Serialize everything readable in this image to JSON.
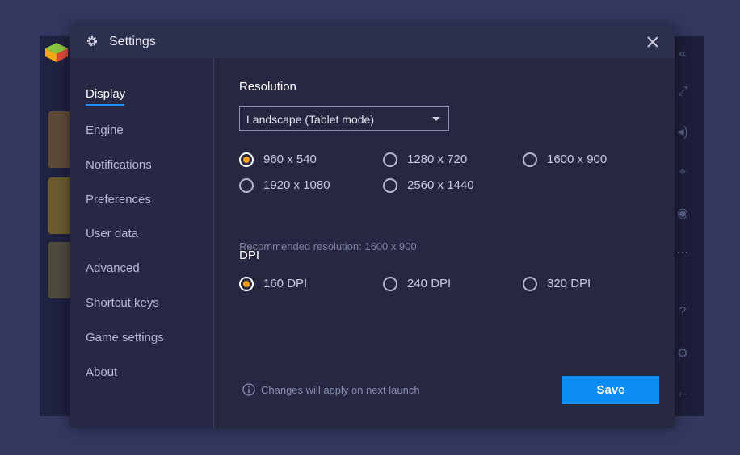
{
  "dialog": {
    "title": "Settings",
    "title_icon": "gear-icon",
    "close_icon": "close-icon"
  },
  "sidebar": {
    "items": [
      {
        "label": "Display",
        "active": true
      },
      {
        "label": "Engine"
      },
      {
        "label": "Notifications"
      },
      {
        "label": "Preferences"
      },
      {
        "label": "User data"
      },
      {
        "label": "Advanced"
      },
      {
        "label": "Shortcut keys"
      },
      {
        "label": "Game settings"
      },
      {
        "label": "About"
      }
    ]
  },
  "display": {
    "resolution_title": "Resolution",
    "orientation_select": {
      "selected": "Landscape (Tablet mode)"
    },
    "resolutions": [
      {
        "label": "960 x 540",
        "checked": true
      },
      {
        "label": "1280 x 720",
        "checked": false
      },
      {
        "label": "1600 x 900",
        "checked": false
      },
      {
        "label": "1920 x 1080",
        "checked": false
      },
      {
        "label": "2560 x 1440",
        "checked": false
      }
    ],
    "recommended": "Recommended resolution: 1600 x 900",
    "dpi_title": "DPI",
    "dpi_options": [
      {
        "label": "160 DPI",
        "checked": true
      },
      {
        "label": "240 DPI",
        "checked": false
      },
      {
        "label": "320 DPI",
        "checked": false
      }
    ]
  },
  "footer": {
    "note": "Changes will apply on next launch",
    "note_icon": "info-icon",
    "save_label": "Save"
  },
  "colors": {
    "accent": "#0d8cf4",
    "radio_selected": "#ff9f1a",
    "dialog_bg": "#272944"
  }
}
